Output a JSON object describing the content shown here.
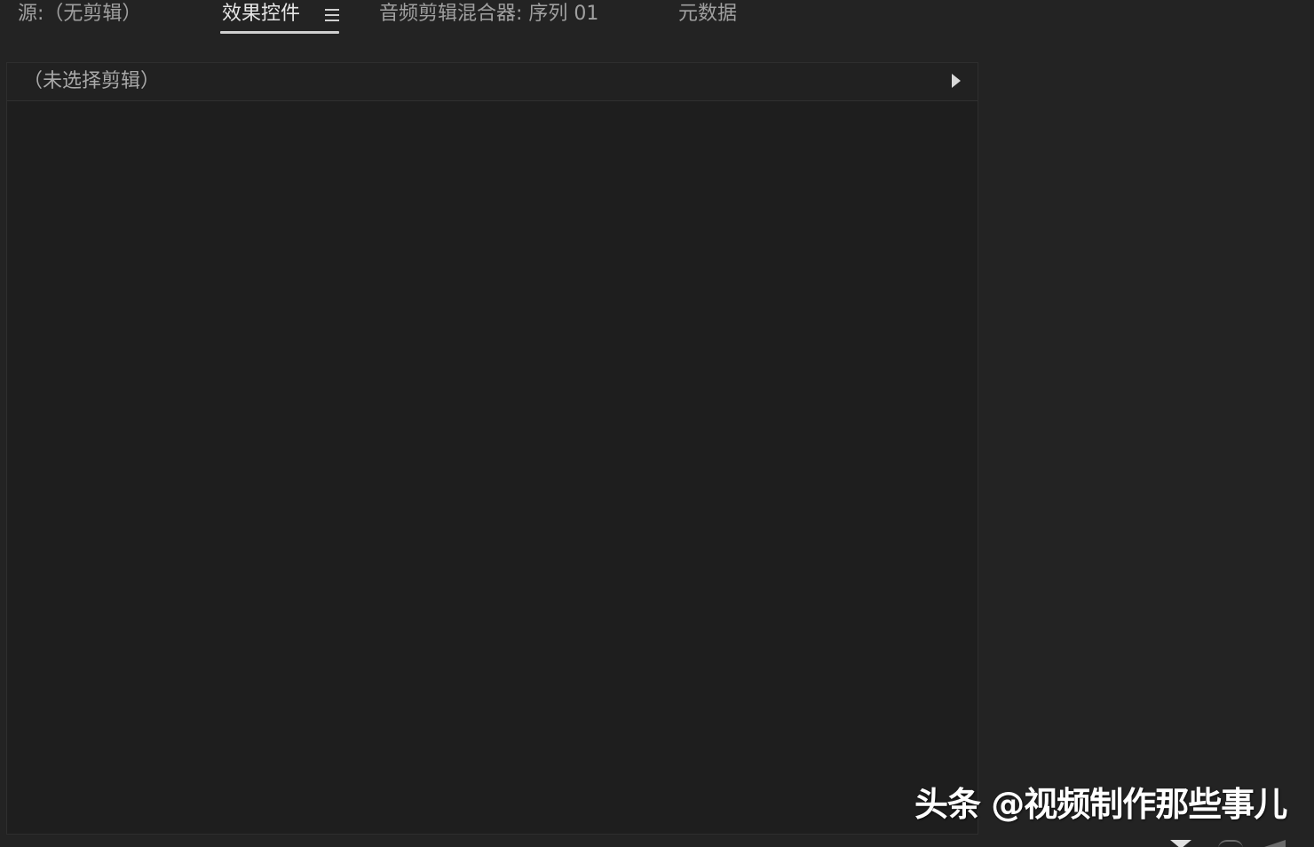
{
  "tabs": {
    "source": "源:（无剪辑）",
    "effect_controls": "效果控件",
    "audio_clip_mixer": "音频剪辑混合器: 序列 01",
    "metadata": "元数据"
  },
  "panel": {
    "clip_label": "（未选择剪辑）"
  },
  "watermark": {
    "text": "头条 @视频制作那些事儿"
  },
  "icons": {
    "menu": "hamburger-menu-icon",
    "expand": "triangle-right-icon",
    "filter": "funnel-icon"
  },
  "colors": {
    "background": "#232323",
    "panel_background": "#1e1e1e",
    "active_tab_text": "#e6e6e6",
    "inactive_tab_text": "#a0a0a0",
    "tab_underline": "#cfcfcf"
  }
}
